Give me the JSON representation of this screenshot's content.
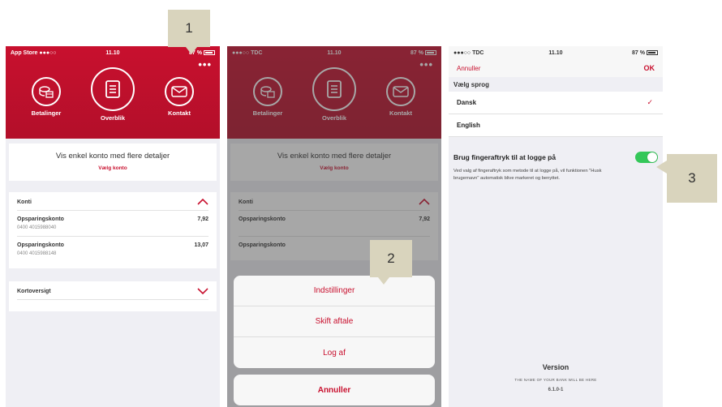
{
  "phone1": {
    "status": {
      "left": "App Store ●●●○○",
      "time": "11.10",
      "battery": "87 %"
    },
    "more": "•••",
    "nav": [
      {
        "label": "Betalinger",
        "icon": "coins-icon"
      },
      {
        "label": "Overblik",
        "icon": "document-icon"
      },
      {
        "label": "Kontakt",
        "icon": "envelope-icon"
      }
    ],
    "info": {
      "title": "Vis enkel konto med flere detaljer",
      "link": "Vælg konto"
    },
    "konti": {
      "header": "Konti",
      "accounts": [
        {
          "name": "Opsparingskonto",
          "amount": "7,92",
          "number": "0400 4015988040"
        },
        {
          "name": "Opsparingskonto",
          "amount": "13,07",
          "number": "0400 4015988148"
        }
      ]
    },
    "kort": {
      "header": "Kortoversigt"
    }
  },
  "phone2": {
    "status": {
      "left": "●●●○○ TDC",
      "time": "11.10",
      "battery": "87 %"
    },
    "more": "•••",
    "nav": [
      {
        "label": "Betalinger",
        "icon": "coins-icon"
      },
      {
        "label": "Overblik",
        "icon": "document-icon"
      },
      {
        "label": "Kontakt",
        "icon": "envelope-icon"
      }
    ],
    "info": {
      "title": "Vis enkel konto med flere detaljer",
      "link": "Vælg konto"
    },
    "konti": {
      "header": "Konti",
      "accounts": [
        {
          "name": "Opsparingskonto",
          "amount": "7,92",
          "number": ""
        },
        {
          "name": "Opsparingskonto",
          "amount": "",
          "number": ""
        }
      ]
    },
    "sheet": {
      "options": [
        "Indstillinger",
        "Skift aftale",
        "Log af"
      ],
      "cancel": "Annuller"
    }
  },
  "phone3": {
    "status": {
      "left": "●●●○○ TDC",
      "time": "11.10",
      "battery": "87 %"
    },
    "cancel": "Annuller",
    "ok": "OK",
    "language_label": "Vælg sprog",
    "languages": [
      {
        "label": "Dansk",
        "selected": true,
        "check": "✓"
      },
      {
        "label": "English",
        "selected": false,
        "check": ""
      }
    ],
    "fingerprint": {
      "title": "Brug fingeraftryk til at logge på",
      "enabled": true,
      "description": "Ved valg af fingeraftryk som metode til at logge på, vil funktionen \"Husk brugernavn\" automatisk blive markeret og benyttet."
    },
    "version": {
      "title": "Version",
      "bank_name": "THE NAME OF YOUR BANK WILL BE HERE",
      "number": "6.1.0-1"
    }
  },
  "callouts": {
    "one": "1",
    "two": "2",
    "three": "3"
  },
  "colors": {
    "brand_red": "#c8102e",
    "toggle_green": "#34c759",
    "callout_bg": "#d9d4bd"
  }
}
